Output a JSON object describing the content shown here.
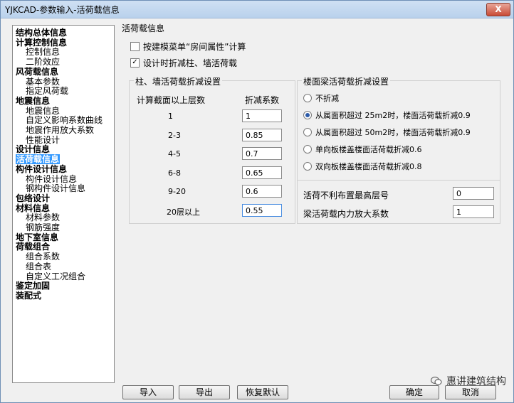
{
  "window": {
    "title": "YJKCAD-参数输入-活荷载信息",
    "close_glyph": "X"
  },
  "tree": {
    "items": [
      {
        "label": "结构总体信息",
        "level": 0
      },
      {
        "label": "计算控制信息",
        "level": 0
      },
      {
        "label": "控制信息",
        "level": 1
      },
      {
        "label": "二阶效应",
        "level": 1
      },
      {
        "label": "风荷载信息",
        "level": 0
      },
      {
        "label": "基本参数",
        "level": 1
      },
      {
        "label": "指定风荷载",
        "level": 1
      },
      {
        "label": "地震信息",
        "level": 0
      },
      {
        "label": "地震信息",
        "level": 1
      },
      {
        "label": "自定义影响系数曲线",
        "level": 1
      },
      {
        "label": "地震作用放大系数",
        "level": 1
      },
      {
        "label": "性能设计",
        "level": 1
      },
      {
        "label": "设计信息",
        "level": 0
      },
      {
        "label": "活荷载信息",
        "level": 0,
        "selected": true
      },
      {
        "label": "构件设计信息",
        "level": 0
      },
      {
        "label": "构件设计信息",
        "level": 1
      },
      {
        "label": "钢构件设计信息",
        "level": 1
      },
      {
        "label": "包络设计",
        "level": 0
      },
      {
        "label": "材料信息",
        "level": 0
      },
      {
        "label": "材料参数",
        "level": 1
      },
      {
        "label": "钢筋强度",
        "level": 1
      },
      {
        "label": "地下室信息",
        "level": 0
      },
      {
        "label": "荷载组合",
        "level": 0
      },
      {
        "label": "组合系数",
        "level": 1
      },
      {
        "label": "组合表",
        "level": 1
      },
      {
        "label": "自定义工况组合",
        "level": 1
      },
      {
        "label": "鉴定加固",
        "level": 0
      },
      {
        "label": "装配式",
        "level": 0
      }
    ]
  },
  "live_load": {
    "section_title": "活荷载信息",
    "checkbox_room_attr": {
      "label": "按建模菜单“房间属性”计算",
      "checked": false
    },
    "checkbox_reduce": {
      "label": "设计时折减柱、墙活荷载",
      "checked": true
    }
  },
  "column_panel": {
    "title": "柱、墙活荷载折减设置",
    "col_floors": "计算截面以上层数",
    "col_factor": "折减系数",
    "rows": [
      {
        "floors": "1",
        "factor": "1"
      },
      {
        "floors": "2-3",
        "factor": "0.85"
      },
      {
        "floors": "4-5",
        "factor": "0.7"
      },
      {
        "floors": "6-8",
        "factor": "0.65"
      },
      {
        "floors": "9-20",
        "factor": "0.6"
      },
      {
        "floors": "20层以上",
        "factor": "0.55"
      }
    ]
  },
  "beam_panel": {
    "title": "楼面梁活荷载折减设置",
    "options": [
      {
        "label": "不折减",
        "selected": false
      },
      {
        "label": "从属面积超过 25m2时，楼面活荷载折减0.9",
        "selected": true
      },
      {
        "label": "从属面积超过 50m2时，楼面活荷载折减0.9",
        "selected": false
      },
      {
        "label": "单向板楼盖楼面活荷载折减0.6",
        "selected": false
      },
      {
        "label": "双向板楼盖楼面活荷载折减0.8",
        "selected": false
      }
    ]
  },
  "misc_panel": {
    "max_floor_label": "活荷不利布置最高层号",
    "max_floor_value": "0",
    "amplify_label": "梁活荷载内力放大系数",
    "amplify_value": "1"
  },
  "buttons": {
    "import": "导入",
    "export": "导出",
    "restore": "恢复默认",
    "ok": "确定",
    "cancel": "取消"
  },
  "watermark": {
    "text": "惠讲建筑结构"
  },
  "check_glyph": "✓"
}
